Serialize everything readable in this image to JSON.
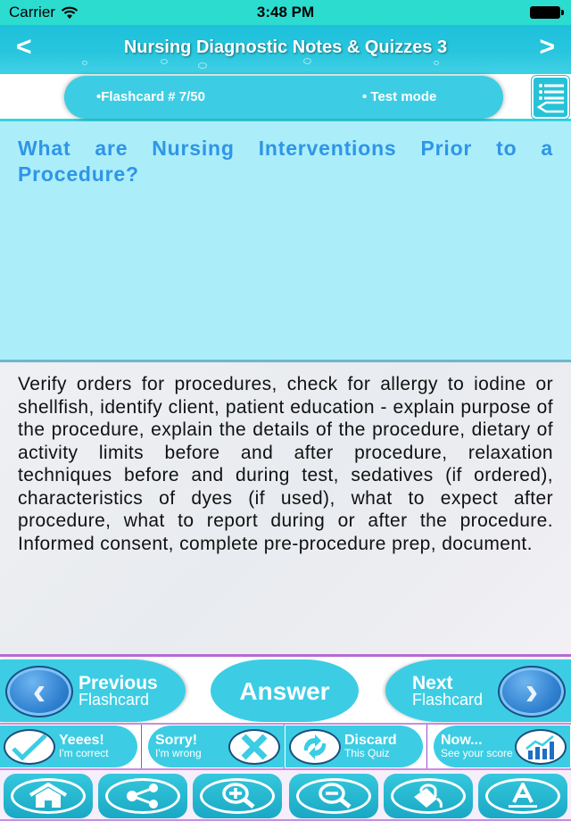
{
  "status_bar": {
    "carrier": "Carrier",
    "time": "3:48 PM",
    "wifi_icon": "wifi-icon",
    "battery_icon": "battery-full-icon"
  },
  "nav": {
    "title": "Nursing Diagnostic Notes & Quizzes 3",
    "back_label": "<",
    "forward_label": ">"
  },
  "info": {
    "flashcard_label": "•Flashcard #  7/50",
    "mode_label": "• Test mode",
    "list_icon": "list-edit-icon"
  },
  "card": {
    "question": "What are Nursing Interventions Prior to a Procedure?",
    "answer": "Verify orders for procedures, check for allergy to iodine or shellfish, identify client, patient education - explain purpose of the procedure, explain the details of the procedure, dietary of activity limits before and after procedure, relaxation techniques before and during test, sedatives (if ordered), characteristics of dyes (if used), what to expect after procedure, what to report during or after the procedure. Informed consent, complete pre-procedure prep, document."
  },
  "navigation_buttons": {
    "previous": {
      "main": "Previous",
      "sub": "Flashcard",
      "arrow": "‹"
    },
    "answer": {
      "label": "Answer"
    },
    "next": {
      "main": "Next",
      "sub": "Flashcard",
      "arrow": "›"
    }
  },
  "quiz_buttons": [
    {
      "main": "Yeees!",
      "sub": "I'm correct",
      "icon": "checkmark-icon"
    },
    {
      "main": "Sorry!",
      "sub": "I'm wrong",
      "icon": "x-mark-icon"
    },
    {
      "main": "Discard",
      "sub": "This Quiz",
      "icon": "recycle-icon"
    },
    {
      "main": "Now...",
      "sub": "See your score",
      "icon": "bar-chart-icon"
    }
  ],
  "toolbar": [
    {
      "name": "home",
      "icon": "home-icon"
    },
    {
      "name": "share",
      "icon": "share-icon"
    },
    {
      "name": "zoom-in",
      "icon": "zoom-in-icon"
    },
    {
      "name": "zoom-out",
      "icon": "zoom-out-icon"
    },
    {
      "name": "fill-color",
      "icon": "paint-bucket-icon"
    },
    {
      "name": "font",
      "icon": "font-icon"
    }
  ],
  "colors": {
    "accent": "#3ccde4",
    "question_text": "#2f95e6",
    "question_bg": "#abeefa",
    "status_bar": "#2cdccf",
    "divider": "#b56ad6"
  }
}
